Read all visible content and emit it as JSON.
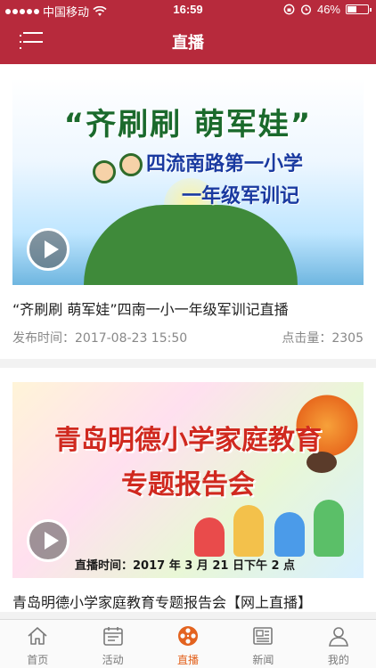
{
  "status_bar": {
    "carrier": "中国移动",
    "time": "16:59",
    "battery_percent": "46%",
    "battery_level": 0.46
  },
  "nav": {
    "title": "直播",
    "menu_icon": "menu-icon"
  },
  "cards": [
    {
      "banner_title": "“齐刷刷 萌军娃”",
      "banner_sub1": "四流南路第一小学",
      "banner_sub2": "一年级军训记",
      "title": "“齐刷刷 萌军娃”四南一小一年级军训记直播",
      "publish_time": "发布时间：2017-08-23 15:50",
      "views": "点击量：2305"
    },
    {
      "banner_line1": "青岛明德小学家庭教育",
      "banner_line2": "专题报告会",
      "banner_caption": "直播时间：2017 年 3 月 21 日下午 2 点",
      "title": "青岛明德小学家庭教育专题报告会【网上直播】"
    }
  ],
  "tabs": [
    {
      "label": "首页",
      "icon": "home-icon"
    },
    {
      "label": "活动",
      "icon": "calendar-icon"
    },
    {
      "label": "直播",
      "icon": "film-reel-icon",
      "active": true
    },
    {
      "label": "新闻",
      "icon": "newspaper-icon"
    },
    {
      "label": "我的",
      "icon": "user-icon"
    }
  ],
  "colors": {
    "brand": "#b72a3c",
    "active_tab": "#e3631f",
    "inactive_tab": "#7a7a7a"
  }
}
